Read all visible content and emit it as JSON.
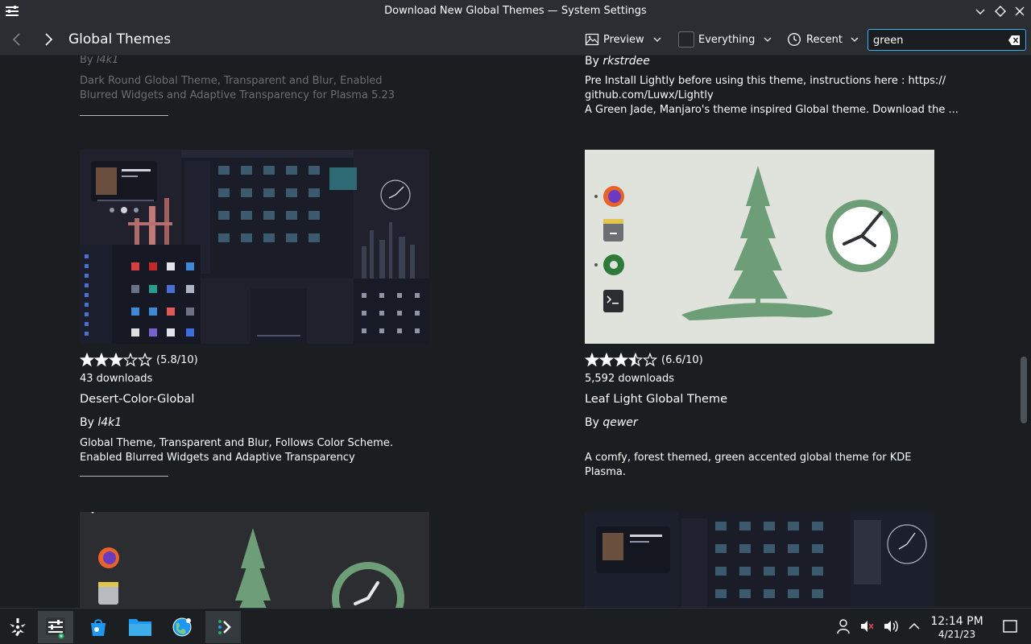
{
  "window": {
    "title": "Download New Global Themes — System Settings"
  },
  "toolbar": {
    "page_title": "Global Themes",
    "preview_label": "Preview",
    "filter_label": "Everything",
    "sort_label": "Recent",
    "search_value": "green"
  },
  "cards": {
    "top_left": {
      "author_prefix": "By ",
      "author": "l4k1",
      "description": "Dark Round Global Theme, Transparent and Blur, Enabled Blurred Widgets and Adaptive Transparency for Plasma 5.23"
    },
    "top_right": {
      "author_prefix": "By ",
      "author": "rkstrdee",
      "description_1": "Pre Install Lightly before using this theme, instructions here : https://",
      "description_2": "github.com/Luwx/Lightly",
      "description_3": "A Green Jade, Manjaro's theme inspired Global theme. Download the ..."
    },
    "desert": {
      "rating_value": 5.8,
      "rating": "(5.8/10)",
      "downloads": "43 downloads",
      "name": "Desert-Color-Global",
      "author_prefix": "By ",
      "author": "l4k1",
      "description": "Global Theme, Transparent and Blur, Follows Color Scheme. Enabled Blurred Widgets and Adaptive Transparency"
    },
    "leaf": {
      "rating_value": 6.6,
      "rating": "(6.6/10)",
      "downloads": "5,592 downloads",
      "name": "Leaf Light Global Theme",
      "author_prefix": "By ",
      "author": "qewer",
      "description": "A comfy, forest themed, green accented global theme for KDE Plasma."
    },
    "bottom_left": {},
    "bottom_right": {}
  },
  "scrollbar": {
    "position_fraction": 0.62,
    "visible_fraction": 0.12
  },
  "taskbar": {
    "apps": [
      "application-launcher-icon",
      "system-settings-icon",
      "discover-store-icon",
      "file-manager-icon",
      "web-browser-icon",
      "terminal-icon"
    ],
    "clock_time": "12:14 PM",
    "clock_date": "4/21/23"
  },
  "colors": {
    "accent": "#3daee9",
    "window_bg": "#1b1e20",
    "header_bg": "#2a2e32",
    "theme_green": "#6e9e78",
    "leaf_bg": "#dfe3dc"
  }
}
